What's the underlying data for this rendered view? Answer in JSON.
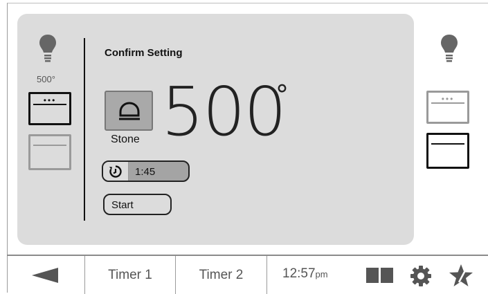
{
  "left_panel": {
    "upper_oven_temp": "500°",
    "light_icon": "lightbulb-icon",
    "upper_oven_icon": "oven-upper-icon",
    "lower_oven_icon": "oven-lower-icon"
  },
  "main": {
    "title": "Confirm Setting",
    "mode_icon": "stone-icon",
    "mode_label": "Stone",
    "temperature": "500",
    "degree_symbol": "°",
    "timer_icon": "timer-icon",
    "timer_value": "1:45",
    "start_label": "Start"
  },
  "right_panel": {
    "light_icon": "lightbulb-icon",
    "upper_oven_icon": "oven-upper-icon",
    "lower_oven_icon": "oven-lower-icon"
  },
  "bottom_bar": {
    "back_icon": "back-arrow-icon",
    "timer1_label": "Timer 1",
    "timer2_label": "Timer 2",
    "time": "12:57",
    "time_suffix": "pm",
    "dual_oven_icon": "dual-oven-icon",
    "settings_icon": "gear-icon",
    "favorites_icon": "star-icon"
  },
  "colors": {
    "panel_bg": "#dcdcdc",
    "active_outline": "#111111",
    "inactive_outline": "#9a9a9a",
    "icon_gray": "#666666"
  }
}
